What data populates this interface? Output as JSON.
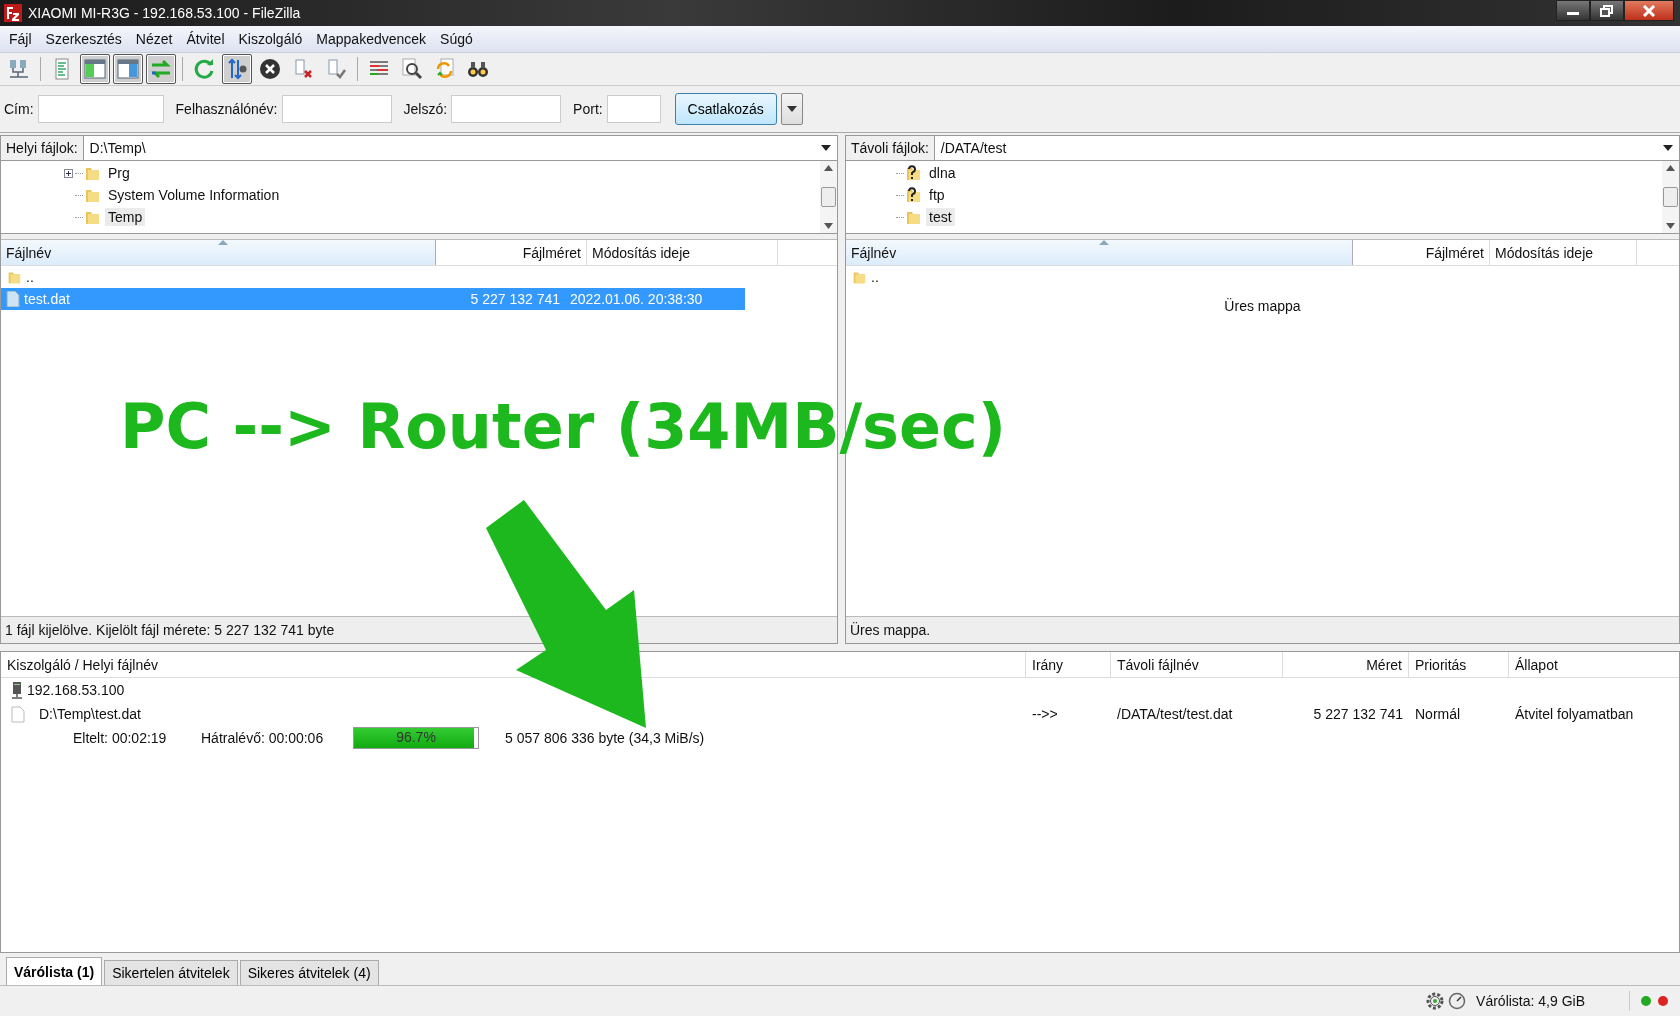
{
  "window": {
    "title": "XIAOMI MI-R3G - 192.168.53.100 - FileZilla"
  },
  "menu": [
    "Fájl",
    "Szerkesztés",
    "Nézet",
    "Átvitel",
    "Kiszolgáló",
    "Mappakedvencek",
    "Súgó"
  ],
  "toolbar": [
    [
      {
        "kind": "sitemanager",
        "pressed": false
      }
    ],
    [
      {
        "kind": "log",
        "pressed": false
      },
      {
        "kind": "localtree",
        "pressed": true
      },
      {
        "kind": "remotetree",
        "pressed": true
      },
      {
        "kind": "queue",
        "pressed": true
      }
    ],
    [
      {
        "kind": "refresh",
        "pressed": false
      },
      {
        "kind": "filter",
        "pressed": true
      },
      {
        "kind": "cancel",
        "pressed": false
      },
      {
        "kind": "disconnect",
        "pressed": false
      },
      {
        "kind": "reconnect",
        "pressed": false
      }
    ],
    [
      {
        "kind": "compare",
        "pressed": false
      },
      {
        "kind": "search",
        "pressed": false
      },
      {
        "kind": "sync",
        "pressed": false
      },
      {
        "kind": "find",
        "pressed": false
      }
    ]
  ],
  "quickconnect": {
    "fields": [
      {
        "label": "Cím:"
      },
      {
        "label": "Felhasználónév:"
      },
      {
        "label": "Jelszó:"
      },
      {
        "label": "Port:"
      }
    ],
    "button": "Csatlakozás"
  },
  "local": {
    "label": "Helyi fájlok:",
    "path": "D:\\Temp\\",
    "tree": [
      {
        "name": "Prg",
        "kind": "folder",
        "expandable": true,
        "selected": false
      },
      {
        "name": "System Volume Information",
        "kind": "folder",
        "expandable": false,
        "selected": false
      },
      {
        "name": "Temp",
        "kind": "folder",
        "expandable": false,
        "selected": true
      }
    ],
    "columns": [
      "Fájlnév",
      "Fájlméret",
      "Módosítás ideje"
    ],
    "rows": [
      {
        "name": "..",
        "kind": "parent",
        "selected": false
      },
      {
        "name": "test.dat",
        "kind": "file",
        "size": "5 227 132 741",
        "modified": "2022.01.06. 20:38:30",
        "selected": true
      }
    ],
    "status": "1 fájl kijelölve. Kijelölt fájl mérete: 5 227 132 741 byte"
  },
  "remote": {
    "label": "Távoli fájlok:",
    "path": "/DATA/test",
    "tree": [
      {
        "name": "dlna",
        "kind": "unknown",
        "expandable": false,
        "selected": false
      },
      {
        "name": "ftp",
        "kind": "unknown",
        "expandable": false,
        "selected": false
      },
      {
        "name": "test",
        "kind": "folder",
        "expandable": false,
        "selected": true
      }
    ],
    "columns": [
      "Fájlnév",
      "Fájlméret",
      "Módosítás ideje"
    ],
    "rows": [
      {
        "name": "..",
        "kind": "parent",
        "selected": false
      }
    ],
    "empty_message": "Üres mappa",
    "status": "Üres mappa."
  },
  "queue": {
    "columns": [
      "Kiszolgáló / Helyi fájlnév",
      "Irány",
      "Távoli fájlnév",
      "Méret",
      "Prioritás",
      "Állapot"
    ],
    "server": "192.168.53.100",
    "item": {
      "local": "D:\\Temp\\test.dat",
      "direction": "-->>",
      "remote": "/DATA/test/test.dat",
      "size": "5 227 132 741",
      "priority": "Normál",
      "status": "Átvitel folyamatban"
    },
    "progress": {
      "elapsed": "Eltelt: 00:02:19",
      "remaining": "Hátralévő: 00:00:06",
      "level": 0.967,
      "percent": "96.7%",
      "transferred": "5 057 806 336 byte (34,3 MiB/s)"
    }
  },
  "tabs": [
    {
      "label": "Várólista (1)",
      "selected": true
    },
    {
      "label": "Sikertelen átvitelek",
      "selected": false
    },
    {
      "label": "Sikeres átvitelek (4)",
      "selected": false
    }
  ],
  "status_bar": {
    "queue": "Várólista: 4,9 GiB"
  },
  "annotation": {
    "text": "PC --> Router (34MB/sec)"
  }
}
